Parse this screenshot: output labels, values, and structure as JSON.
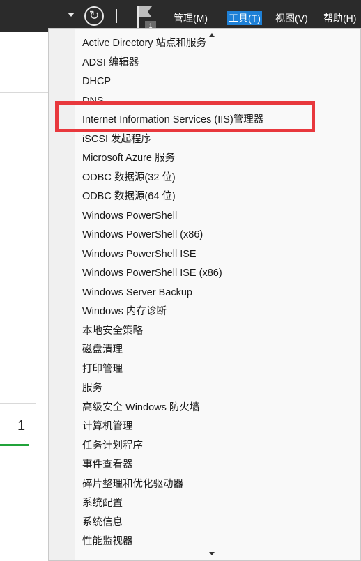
{
  "menubar": {
    "manage": "管理(M)",
    "tools": "工具(T)",
    "view": "视图(V)",
    "help": "帮助(H)",
    "notification_count": "1"
  },
  "background": {
    "tile_count": "1"
  },
  "tools_menu": {
    "items": [
      "Active Directory 站点和服务",
      "ADSI 编辑器",
      "DHCP",
      "DNS",
      "Internet Information Services (IIS)管理器",
      "iSCSI 发起程序",
      "Microsoft Azure 服务",
      "ODBC 数据源(32 位)",
      "ODBC 数据源(64 位)",
      "Windows PowerShell",
      "Windows PowerShell (x86)",
      "Windows PowerShell ISE",
      "Windows PowerShell ISE (x86)",
      "Windows Server Backup",
      "Windows 内存诊断",
      "本地安全策略",
      "磁盘清理",
      "打印管理",
      "服务",
      "高级安全 Windows 防火墙",
      "计算机管理",
      "任务计划程序",
      "事件查看器",
      "碎片整理和优化驱动器",
      "系统配置",
      "系统信息",
      "性能监视器"
    ],
    "highlighted_item": "Internet Information Services (IIS)管理器",
    "highlight_color": "#e8383d"
  },
  "icons": {
    "dropdown": "chevron-down-icon",
    "refresh": "refresh-icon",
    "notification": "flag-icon",
    "scroll_up": "scroll-up-arrow",
    "scroll_down": "scroll-down-arrow"
  },
  "colors": {
    "topbar": "#2b2b2b",
    "active_menu": "#1e80d6",
    "menu_background": "#f9f9f9",
    "status_green": "#21a33a"
  }
}
